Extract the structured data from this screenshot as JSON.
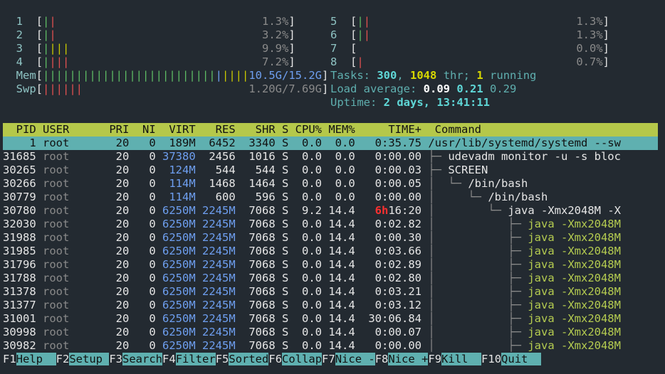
{
  "cpus": [
    {
      "id": "1",
      "bars": "||",
      "pct": "1.3%"
    },
    {
      "id": "2",
      "bars": "||",
      "pct": "3.2%"
    },
    {
      "id": "3",
      "bars": "||||",
      "pct": "9.9%"
    },
    {
      "id": "4",
      "bars": "||||",
      "pct": "7.2%"
    },
    {
      "id": "5",
      "bars": "||",
      "pct": "1.3%"
    },
    {
      "id": "6",
      "bars": "||",
      "pct": "1.3%"
    },
    {
      "id": "7",
      "bars": "",
      "pct": "0.0%"
    },
    {
      "id": "8",
      "bars": "|",
      "pct": "0.7%"
    }
  ],
  "mem": {
    "label": "Mem",
    "bars": "||||||||||||||||||||||||||||||||",
    "value": "10.5G/15.2G"
  },
  "swp": {
    "label": "Swp",
    "bars": "||||||",
    "value": "1.20G/7.69G"
  },
  "tasks": {
    "label": "Tasks:",
    "count": "300",
    "thr": "1048",
    "thr_label": "thr;",
    "running": "1",
    "running_label": "running"
  },
  "load": {
    "label": "Load average:",
    "l1": "0.09",
    "l5": "0.21",
    "l15": "0.29"
  },
  "uptime": {
    "label": "Uptime:",
    "value": "2 days, 13:41:11"
  },
  "columns": [
    "PID",
    "USER",
    "PRI",
    "NI",
    "VIRT",
    "RES",
    "SHR",
    "S",
    "CPU%",
    "MEM%",
    "TIME+",
    "Command"
  ],
  "processes": [
    {
      "pid": "1",
      "user": "root",
      "pri": "20",
      "ni": "0",
      "virt": "189M",
      "res": "6452",
      "shr": "3340",
      "s": "S",
      "cpu": "0.0",
      "mem": "0.0",
      "time": "0:35.75",
      "tree": "",
      "cmd": "/usr/lib/systemd/systemd --sw",
      "selected": true
    },
    {
      "pid": "31685",
      "user": "root",
      "pri": "20",
      "ni": "0",
      "virt": "37380",
      "res": "2456",
      "shr": "1016",
      "s": "S",
      "cpu": "0.0",
      "mem": "0.0",
      "time": "0:00.00",
      "tree": "├─ ",
      "cmd": "udevadm monitor -u -s bloc"
    },
    {
      "pid": "30265",
      "user": "root",
      "pri": "20",
      "ni": "0",
      "virt": "124M",
      "res": "544",
      "shr": "544",
      "s": "S",
      "cpu": "0.0",
      "mem": "0.0",
      "time": "0:00.03",
      "tree": "├─ ",
      "cmd": "SCREEN"
    },
    {
      "pid": "30266",
      "user": "root",
      "pri": "20",
      "ni": "0",
      "virt": "114M",
      "res": "1468",
      "shr": "1464",
      "s": "S",
      "cpu": "0.0",
      "mem": "0.0",
      "time": "0:00.05",
      "tree": "│  └─ ",
      "cmd": "/bin/bash"
    },
    {
      "pid": "30779",
      "user": "root",
      "pri": "20",
      "ni": "0",
      "virt": "114M",
      "res": "600",
      "shr": "596",
      "s": "S",
      "cpu": "0.0",
      "mem": "0.0",
      "time": "0:00.00",
      "tree": "│     └─ ",
      "cmd": "/bin/bash"
    },
    {
      "pid": "30780",
      "user": "root",
      "pri": "20",
      "ni": "0",
      "virt": "6250M",
      "res": "2245M",
      "shr": "7068",
      "s": "S",
      "cpu": "9.2",
      "mem": "14.4",
      "time_h": "6h",
      "time": "16:20",
      "tree": "│        └─ ",
      "cmd": "java -Xmx2048M -X"
    },
    {
      "pid": "32030",
      "user": "root",
      "pri": "20",
      "ni": "0",
      "virt": "6250M",
      "res": "2245M",
      "shr": "7068",
      "s": "S",
      "cpu": "0.0",
      "mem": "14.4",
      "time": "0:02.82",
      "tree": "│           ├─ ",
      "cmd": "java -Xmx2048M"
    },
    {
      "pid": "31988",
      "user": "root",
      "pri": "20",
      "ni": "0",
      "virt": "6250M",
      "res": "2245M",
      "shr": "7068",
      "s": "S",
      "cpu": "0.0",
      "mem": "14.4",
      "time": "0:00.30",
      "tree": "│           ├─ ",
      "cmd": "java -Xmx2048M"
    },
    {
      "pid": "31985",
      "user": "root",
      "pri": "20",
      "ni": "0",
      "virt": "6250M",
      "res": "2245M",
      "shr": "7068",
      "s": "S",
      "cpu": "0.0",
      "mem": "14.4",
      "time": "0:03.66",
      "tree": "│           ├─ ",
      "cmd": "java -Xmx2048M"
    },
    {
      "pid": "31796",
      "user": "root",
      "pri": "20",
      "ni": "0",
      "virt": "6250M",
      "res": "2245M",
      "shr": "7068",
      "s": "S",
      "cpu": "0.0",
      "mem": "14.4",
      "time": "0:02.89",
      "tree": "│           ├─ ",
      "cmd": "java -Xmx2048M"
    },
    {
      "pid": "31788",
      "user": "root",
      "pri": "20",
      "ni": "0",
      "virt": "6250M",
      "res": "2245M",
      "shr": "7068",
      "s": "S",
      "cpu": "0.0",
      "mem": "14.4",
      "time": "0:02.80",
      "tree": "│           ├─ ",
      "cmd": "java -Xmx2048M"
    },
    {
      "pid": "31378",
      "user": "root",
      "pri": "20",
      "ni": "0",
      "virt": "6250M",
      "res": "2245M",
      "shr": "7068",
      "s": "S",
      "cpu": "0.0",
      "mem": "14.4",
      "time": "0:03.21",
      "tree": "│           ├─ ",
      "cmd": "java -Xmx2048M"
    },
    {
      "pid": "31377",
      "user": "root",
      "pri": "20",
      "ni": "0",
      "virt": "6250M",
      "res": "2245M",
      "shr": "7068",
      "s": "S",
      "cpu": "0.0",
      "mem": "14.4",
      "time": "0:03.12",
      "tree": "│           ├─ ",
      "cmd": "java -Xmx2048M"
    },
    {
      "pid": "31001",
      "user": "root",
      "pri": "20",
      "ni": "0",
      "virt": "6250M",
      "res": "2245M",
      "shr": "7068",
      "s": "S",
      "cpu": "0.0",
      "mem": "14.4",
      "time": "30:06.84",
      "tree": "│           ├─ ",
      "cmd": "java -Xmx2048M"
    },
    {
      "pid": "30998",
      "user": "root",
      "pri": "20",
      "ni": "0",
      "virt": "6250M",
      "res": "2245M",
      "shr": "7068",
      "s": "S",
      "cpu": "0.0",
      "mem": "14.4",
      "time": "0:00.07",
      "tree": "│           ├─ ",
      "cmd": "java -Xmx2048M"
    },
    {
      "pid": "30982",
      "user": "root",
      "pri": "20",
      "ni": "0",
      "virt": "6250M",
      "res": "2245M",
      "shr": "7068",
      "s": "S",
      "cpu": "0.0",
      "mem": "14.4",
      "time": "0:00.00",
      "tree": "│           ├─ ",
      "cmd": "java -Xmx2048M"
    }
  ],
  "fkeys": [
    {
      "num": "F1",
      "label": "Help  "
    },
    {
      "num": "F2",
      "label": "Setup "
    },
    {
      "num": "F3",
      "label": "Search"
    },
    {
      "num": "F4",
      "label": "Filter"
    },
    {
      "num": "F5",
      "label": "Sorted"
    },
    {
      "num": "F6",
      "label": "Collap"
    },
    {
      "num": "F7",
      "label": "Nice -"
    },
    {
      "num": "F8",
      "label": "Nice +"
    },
    {
      "num": "F9",
      "label": "Kill  "
    },
    {
      "num": "F10",
      "label": "Quit  "
    }
  ],
  "colors": {
    "background": "#232a31",
    "header_bg": "#b5c84a",
    "selected_bg": "#5fb0b0",
    "accent_cyan": "#5fd7d7"
  }
}
